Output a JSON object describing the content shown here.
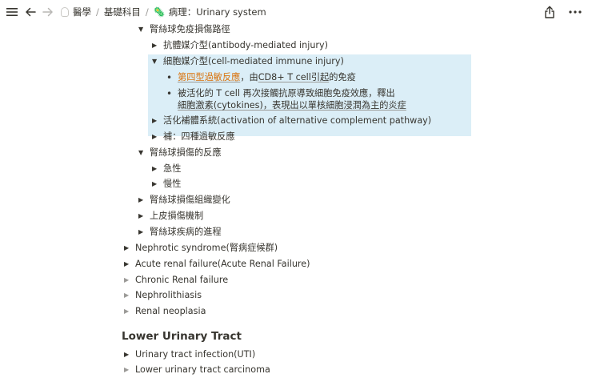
{
  "breadcrumb": {
    "level1": "醫學",
    "level2": "基礎科目",
    "level3_emoji": "🦠",
    "level3": "病理：Urinary system",
    "separator": "/"
  },
  "outline": {
    "l1": "腎絲球免疫損傷路徑",
    "l2": "抗體媒介型(antibody-mediated injury)",
    "l3": "細胞媒介型(cell-mediated immune injury)",
    "b1_a": "第四型過敏反應",
    "b1_b": "，由 ",
    "b1_c": "CD8+ T cell",
    "b1_d": " ",
    "b1_e": "引起",
    "b1_f": "的免疫",
    "b2_line1": "被活化的 T cell 再次接觸抗原導致細胞免疫效應，釋出",
    "b2_line2": "細胞激素(cytokines)，表現出以單核細胞浸潤為主的炎症",
    "l4": "活化補體系統(activation of alternative complement pathway)",
    "l5": "補：四種過敏反應",
    "l6": "腎絲球損傷的反應",
    "l7": "急性",
    "l8": "慢性",
    "l9": "腎絲球損傷組織變化",
    "l10": "上皮損傷機制",
    "l11": "腎絲球疾病的進程",
    "l12": "Nephrotic syndrome(腎病症候群)",
    "l13": "Acute renal failure(Acute Renal Failure)",
    "l14": "Chronic Renal failure",
    "l15": "Nephrolithiasis",
    "l16": "Renal neoplasia",
    "heading": "Lower Urinary Tract",
    "l17": "Urinary tract infection(UTI)",
    "l18": "Lower urinary tract carcinoma"
  },
  "icons": {
    "menu": "menu-icon",
    "back": "back-arrow-icon",
    "forward": "forward-arrow-icon",
    "share": "share-icon",
    "more": "more-icon"
  },
  "colors": {
    "highlight": "#dbeef7",
    "orange_text": "#d9730d",
    "text": "#37352f"
  }
}
